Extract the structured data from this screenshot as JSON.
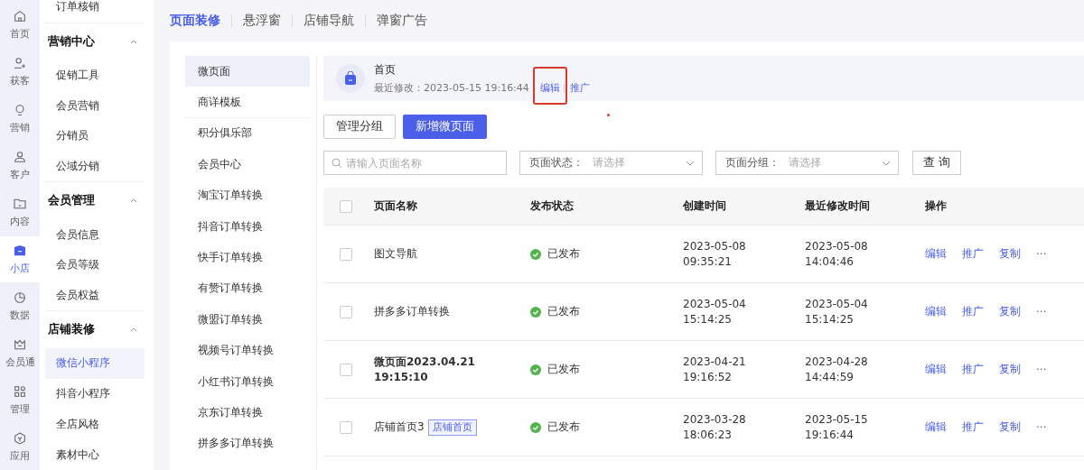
{
  "rail": [
    {
      "label": "首页",
      "kind": "home",
      "selected": false
    },
    {
      "label": "获客",
      "kind": "acquire",
      "selected": false
    },
    {
      "label": "营销",
      "kind": "marketing",
      "selected": false
    },
    {
      "label": "客户",
      "kind": "customer",
      "selected": false
    },
    {
      "label": "内容",
      "kind": "content",
      "selected": false
    },
    {
      "label": "小店",
      "kind": "shop",
      "selected": true
    },
    {
      "label": "数据",
      "kind": "data",
      "selected": false
    },
    {
      "label": "会员通",
      "kind": "member",
      "selected": false
    },
    {
      "label": "管理",
      "kind": "manage",
      "selected": false
    },
    {
      "label": "应用",
      "kind": "apps",
      "selected": false
    }
  ],
  "sidebar": {
    "top_item": "订单核销",
    "groups": [
      {
        "title": "营销中心",
        "expanded": true,
        "items": [
          {
            "label": "促销工具",
            "selected": false
          },
          {
            "label": "会员营销",
            "selected": false
          },
          {
            "label": "分销员",
            "selected": false
          },
          {
            "label": "公域分销",
            "selected": false
          }
        ]
      },
      {
        "title": "会员管理",
        "expanded": true,
        "items": [
          {
            "label": "会员信息",
            "selected": false
          },
          {
            "label": "会员等级",
            "selected": false
          },
          {
            "label": "会员权益",
            "selected": false
          }
        ]
      },
      {
        "title": "店铺装修",
        "expanded": true,
        "items": [
          {
            "label": "微信小程序",
            "selected": true
          },
          {
            "label": "抖音小程序",
            "selected": false
          },
          {
            "label": "全店风格",
            "selected": false
          },
          {
            "label": "素材中心",
            "selected": false
          }
        ]
      }
    ]
  },
  "tabs": [
    {
      "label": "页面装修",
      "selected": true
    },
    {
      "label": "悬浮窗",
      "selected": false
    },
    {
      "label": "店铺导航",
      "selected": false
    },
    {
      "label": "弹窗广告",
      "selected": false
    }
  ],
  "page_menu": [
    {
      "label": "微页面",
      "selected": true
    },
    {
      "label": "商详模板",
      "selected": false
    },
    {
      "label": "积分俱乐部",
      "selected": false
    },
    {
      "label": "会员中心",
      "selected": false
    },
    {
      "label": "淘宝订单转换",
      "selected": false
    },
    {
      "label": "抖音订单转换",
      "selected": false
    },
    {
      "label": "快手订单转换",
      "selected": false
    },
    {
      "label": "有赞订单转换",
      "selected": false
    },
    {
      "label": "微盟订单转换",
      "selected": false
    },
    {
      "label": "视频号订单转换",
      "selected": false
    },
    {
      "label": "小红书订单转换",
      "selected": false
    },
    {
      "label": "京东订单转换",
      "selected": false
    },
    {
      "label": "拼多多订单转换",
      "selected": false
    }
  ],
  "home_card": {
    "title": "首页",
    "modified": "最近修改：2023-05-15 19:16:44",
    "actions": [
      "编辑",
      "推广"
    ]
  },
  "buttons": [
    {
      "label": "管理分组",
      "kind": "default"
    },
    {
      "label": "新增微页面",
      "kind": "primary"
    }
  ],
  "filters": {
    "search": {
      "placeholder": "请输入页面名称"
    },
    "selects": [
      {
        "label": "页面状态：",
        "placeholder": "请选择"
      },
      {
        "label": "页面分组：",
        "placeholder": "请选择"
      }
    ],
    "query": "查 询"
  },
  "table": {
    "select_all_checked": false,
    "columns": [
      "页面名称",
      "发布状态",
      "创建时间",
      "最近修改时间",
      "操作"
    ],
    "rows": [
      {
        "checked": false,
        "name": "图文导航",
        "bold": false,
        "status": "已发布",
        "created": [
          "2023-05-08",
          "09:35:21"
        ],
        "modified": [
          "2023-05-08",
          "14:04:46"
        ],
        "actions": [
          "编辑",
          "推广",
          "复制",
          "···"
        ]
      },
      {
        "checked": false,
        "name": "拼多多订单转换",
        "bold": false,
        "status": "已发布",
        "created": [
          "2023-05-04",
          "15:14:25"
        ],
        "modified": [
          "2023-05-04",
          "15:14:25"
        ],
        "actions": [
          "编辑",
          "推广",
          "复制",
          "···"
        ]
      },
      {
        "checked": false,
        "name": "微页面2023.04.21 19:15:10",
        "bold": true,
        "status": "已发布",
        "created": [
          "2023-04-21",
          "19:16:52"
        ],
        "modified": [
          "2023-04-28",
          "14:44:59"
        ],
        "actions": [
          "编辑",
          "推广",
          "复制",
          "···"
        ]
      },
      {
        "checked": false,
        "name": "店铺首页3",
        "tag": "店铺首页",
        "bold": false,
        "status": "已发布",
        "created": [
          "2023-03-28",
          "18:06:23"
        ],
        "modified": [
          "2023-05-15",
          "19:16:44"
        ],
        "actions": [
          "编辑",
          "推广",
          "复制",
          "···"
        ]
      }
    ]
  }
}
